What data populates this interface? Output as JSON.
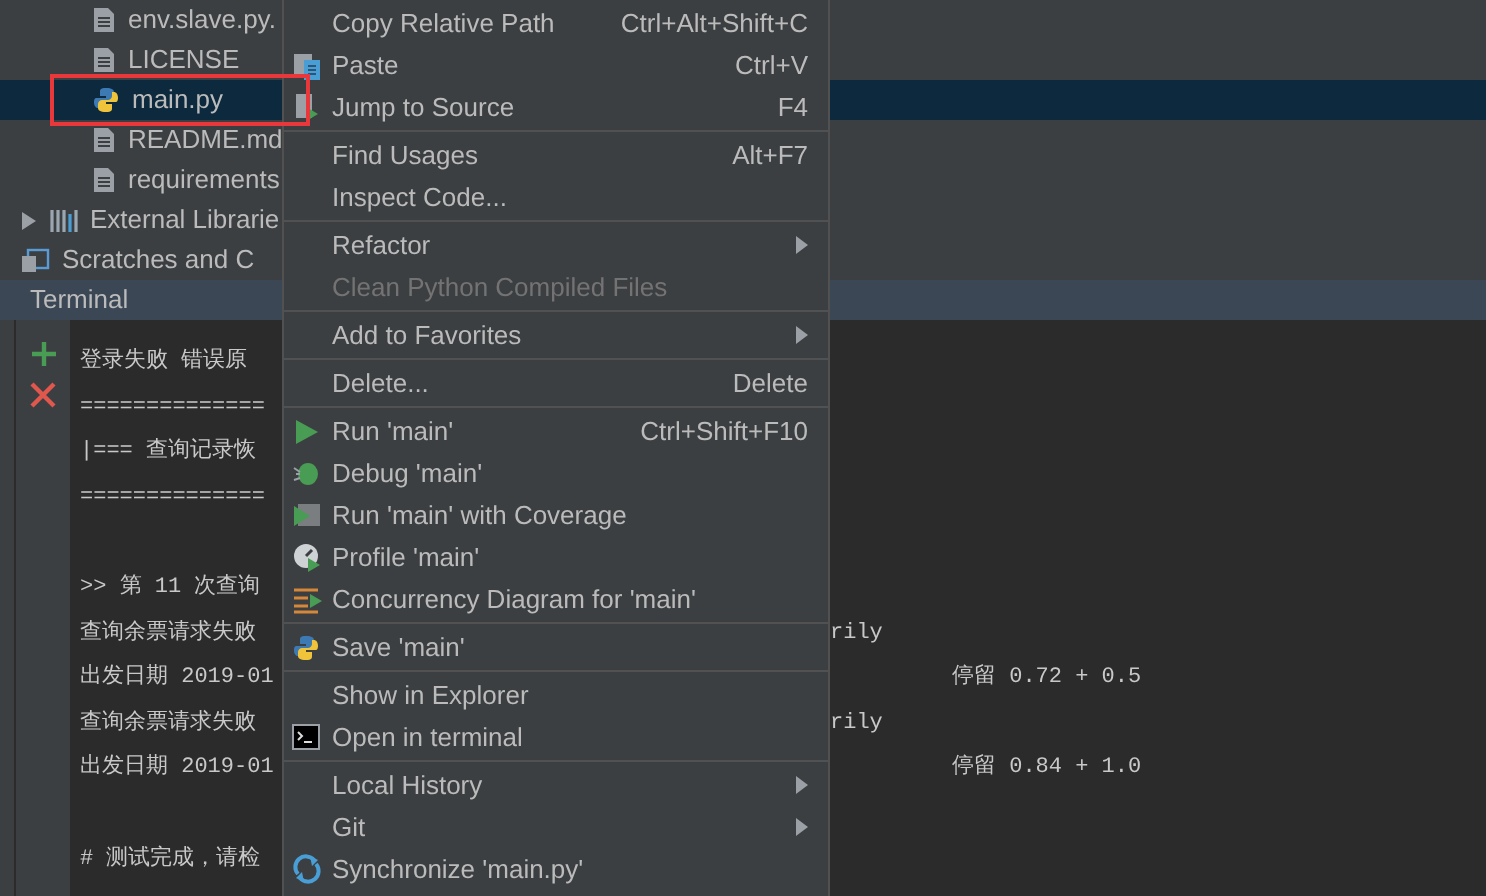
{
  "project_tree": {
    "items": [
      {
        "label": "env.slave.py.",
        "kind": "file",
        "selected": false,
        "highlighted": false
      },
      {
        "label": "LICENSE",
        "kind": "file",
        "selected": false,
        "highlighted": false
      },
      {
        "label": "main.py",
        "kind": "python",
        "selected": true,
        "highlighted": true
      },
      {
        "label": "README.md",
        "kind": "file",
        "selected": false,
        "highlighted": false
      },
      {
        "label": "requirements",
        "kind": "file",
        "selected": false,
        "highlighted": false
      },
      {
        "label": "External Librarie",
        "kind": "libraries",
        "selected": false,
        "highlighted": false,
        "expanded": false
      },
      {
        "label": "Scratches and C",
        "kind": "scratches",
        "selected": false,
        "highlighted": false
      }
    ]
  },
  "terminal": {
    "title": "Terminal",
    "lines": [
      {
        "kind": "plain",
        "text": "登录失败 错误原"
      },
      {
        "kind": "plain",
        "text": "=============="
      },
      {
        "kind": "plain",
        "text": " |=== 查询记录恢"
      },
      {
        "kind": "plain",
        "text": "=============="
      },
      {
        "kind": "blank"
      },
      {
        "kind": "plain",
        "text": ">> 第 11 次查询"
      },
      {
        "kind": "wrapped",
        "text": "查询余票请求失败",
        "tail": "rily"
      },
      {
        "kind": "stats",
        "text": "出发日期 2019-01",
        "tail": "停留 0.72 + 0.5"
      },
      {
        "kind": "wrapped",
        "text": "查询余票请求失败",
        "tail": "rily"
      },
      {
        "kind": "stats",
        "text": "出发日期 2019-01",
        "tail": "停留 0.84 + 1.0"
      },
      {
        "kind": "blank"
      },
      {
        "kind": "plain",
        "text": "# 测试完成，请检"
      }
    ]
  },
  "context_menu": {
    "groups": [
      [
        {
          "label": "Copy Relative Path",
          "shortcut": "Ctrl+Alt+Shift+C",
          "disabled": false,
          "submenu": false
        },
        {
          "label": "Paste",
          "shortcut": "Ctrl+V",
          "disabled": false,
          "submenu": false
        },
        {
          "label": "Jump to Source",
          "shortcut": "F4",
          "disabled": false,
          "submenu": false
        }
      ],
      [
        {
          "label": "Find Usages",
          "shortcut": "Alt+F7",
          "disabled": false,
          "submenu": false
        },
        {
          "label": "Inspect Code...",
          "disabled": false,
          "submenu": false
        }
      ],
      [
        {
          "label": "Refactor",
          "disabled": false,
          "submenu": true
        },
        {
          "label": "Clean Python Compiled Files",
          "disabled": true,
          "submenu": false
        }
      ],
      [
        {
          "label": "Add to Favorites",
          "disabled": false,
          "submenu": true
        }
      ],
      [
        {
          "label": "Delete...",
          "shortcut": "Delete",
          "disabled": false,
          "submenu": false
        }
      ],
      [
        {
          "label": "Run 'main'",
          "shortcut": "Ctrl+Shift+F10",
          "disabled": false,
          "submenu": false
        },
        {
          "label": "Debug 'main'",
          "disabled": false,
          "submenu": false
        },
        {
          "label": "Run 'main' with Coverage",
          "disabled": false,
          "submenu": false
        },
        {
          "label": "Profile 'main'",
          "disabled": false,
          "submenu": false
        },
        {
          "label": "Concurrency Diagram for 'main'",
          "disabled": false,
          "submenu": false
        }
      ],
      [
        {
          "label": "Save 'main'",
          "disabled": false,
          "submenu": false
        }
      ],
      [
        {
          "label": "Show in Explorer",
          "disabled": false,
          "submenu": false
        },
        {
          "label": "Open in terminal",
          "disabled": false,
          "submenu": false
        }
      ],
      [
        {
          "label": "Local History",
          "disabled": false,
          "submenu": true
        },
        {
          "label": "Git",
          "disabled": false,
          "submenu": true
        },
        {
          "label": "Synchronize 'main.py'",
          "disabled": false,
          "submenu": false
        }
      ]
    ]
  }
}
